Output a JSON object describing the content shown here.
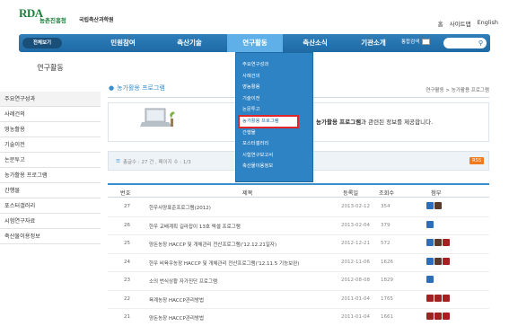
{
  "header": {
    "logo_main": "RDA",
    "logo_org": "농촌진흥청",
    "logo_inst": "국립축산과학원",
    "links": [
      "홈",
      "사이트맵",
      "English"
    ]
  },
  "nav": {
    "all_menu": "전체보기",
    "items": [
      "민원참여",
      "축산기술",
      "연구활동",
      "축산소식",
      "기관소개"
    ],
    "search_label": "통합검색"
  },
  "dropdown": {
    "items": [
      "주요연구성과",
      "사례건의",
      "영농활용",
      "기술이전",
      "논문투고",
      "농가활용 프로그램",
      "간행물",
      "포스터갤러리",
      "시험연구보고서",
      "축산물이용정보"
    ],
    "selected_index": 5
  },
  "sidebar": {
    "title": "연구활동",
    "items": [
      "주요연구성과",
      "사례건의",
      "영농활용",
      "기술이전",
      "논문투고",
      "농가활용 프로그램",
      "간행물",
      "포스터갤러리",
      "시험연구자료",
      "축산물이용정보"
    ]
  },
  "main": {
    "title": "농가활용 프로그램",
    "breadcrumb": "연구활동 > 농가활용 프로그램",
    "banner_prefix": "농가활용 프로그램",
    "banner_suffix": "과 관련된 정보를 제공합니다.",
    "count_text": "총글수 : 27 건 , 페이지 수 : 1/3",
    "rss": "RSS"
  },
  "table": {
    "headers": [
      "번호",
      "제목",
      "등록일",
      "조회수",
      "첨부"
    ],
    "rows": [
      {
        "num": "27",
        "title": "한우사양표준프로그램(2012)",
        "date": "2013-02-12",
        "views": "354",
        "files": [
          "hwp",
          "zip"
        ]
      },
      {
        "num": "26",
        "title": "한우 교배계획 길라잡이 13호 엑셀 프로그램",
        "date": "2013-02-04",
        "views": "379",
        "files": [
          "hwp"
        ]
      },
      {
        "num": "25",
        "title": "양돈농장 HACCP 및 개체관리 전산프로그램('12.12.21일자)",
        "date": "2012-12-21",
        "views": "572",
        "files": [
          "hwp",
          "zip",
          "pdf"
        ]
      },
      {
        "num": "24",
        "title": "한우 비육우농장 HACCP 및 개체관리 전산프로그램('12.11.5 기능보완)",
        "date": "2012-11-06",
        "views": "1626",
        "files": [
          "hwp",
          "zip",
          "pdf"
        ]
      },
      {
        "num": "23",
        "title": "소의 번식상황 자가진단 프로그램",
        "date": "2012-08-08",
        "views": "1829",
        "files": [
          "hwp"
        ]
      },
      {
        "num": "22",
        "title": "육계농장 HACCP관리방법",
        "date": "2011-01-04",
        "views": "1765",
        "files": [
          "pdf",
          "pdf",
          "pdf"
        ]
      },
      {
        "num": "21",
        "title": "양돈농장 HACCP관리방법",
        "date": "2011-01-04",
        "views": "1661",
        "files": [
          "pdf",
          "pdf",
          "pdf"
        ]
      }
    ]
  }
}
